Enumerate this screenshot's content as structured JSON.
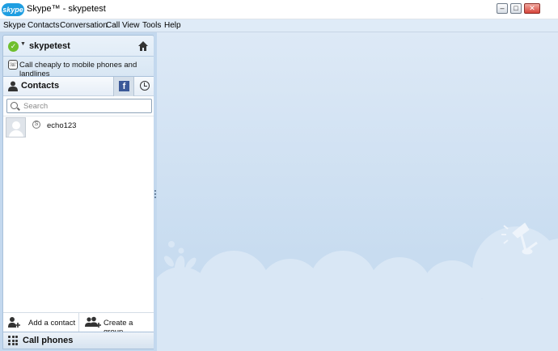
{
  "window": {
    "logo_text": "skype",
    "title": "Skype™ - skypetest",
    "minimize": "–",
    "maximize": "□",
    "close": "✕"
  },
  "menu": [
    "Skype",
    "Contacts",
    "Conversation",
    "Call",
    "View",
    "Tools",
    "Help"
  ],
  "user": {
    "name": "skypetest",
    "status_icon": "online-status-icon",
    "promo": "Call cheaply to mobile phones and landlines"
  },
  "contacts": {
    "title": "Contacts",
    "tabs": [
      {
        "name": "facebook-tab",
        "label": "f"
      },
      {
        "name": "recent-tab",
        "icon": "clock-icon"
      }
    ],
    "search_placeholder": "Search",
    "items": [
      {
        "name": "echo123",
        "status": "skype-status-icon"
      }
    ],
    "add_contact": "Add a contact",
    "create_group": "Create a group"
  },
  "call_phones": "Call phones",
  "colors": {
    "accent": "#1e9ee1",
    "sidebar_bg": "#c3d8ee",
    "online": "#6fbf2e",
    "facebook": "#3b5998"
  }
}
